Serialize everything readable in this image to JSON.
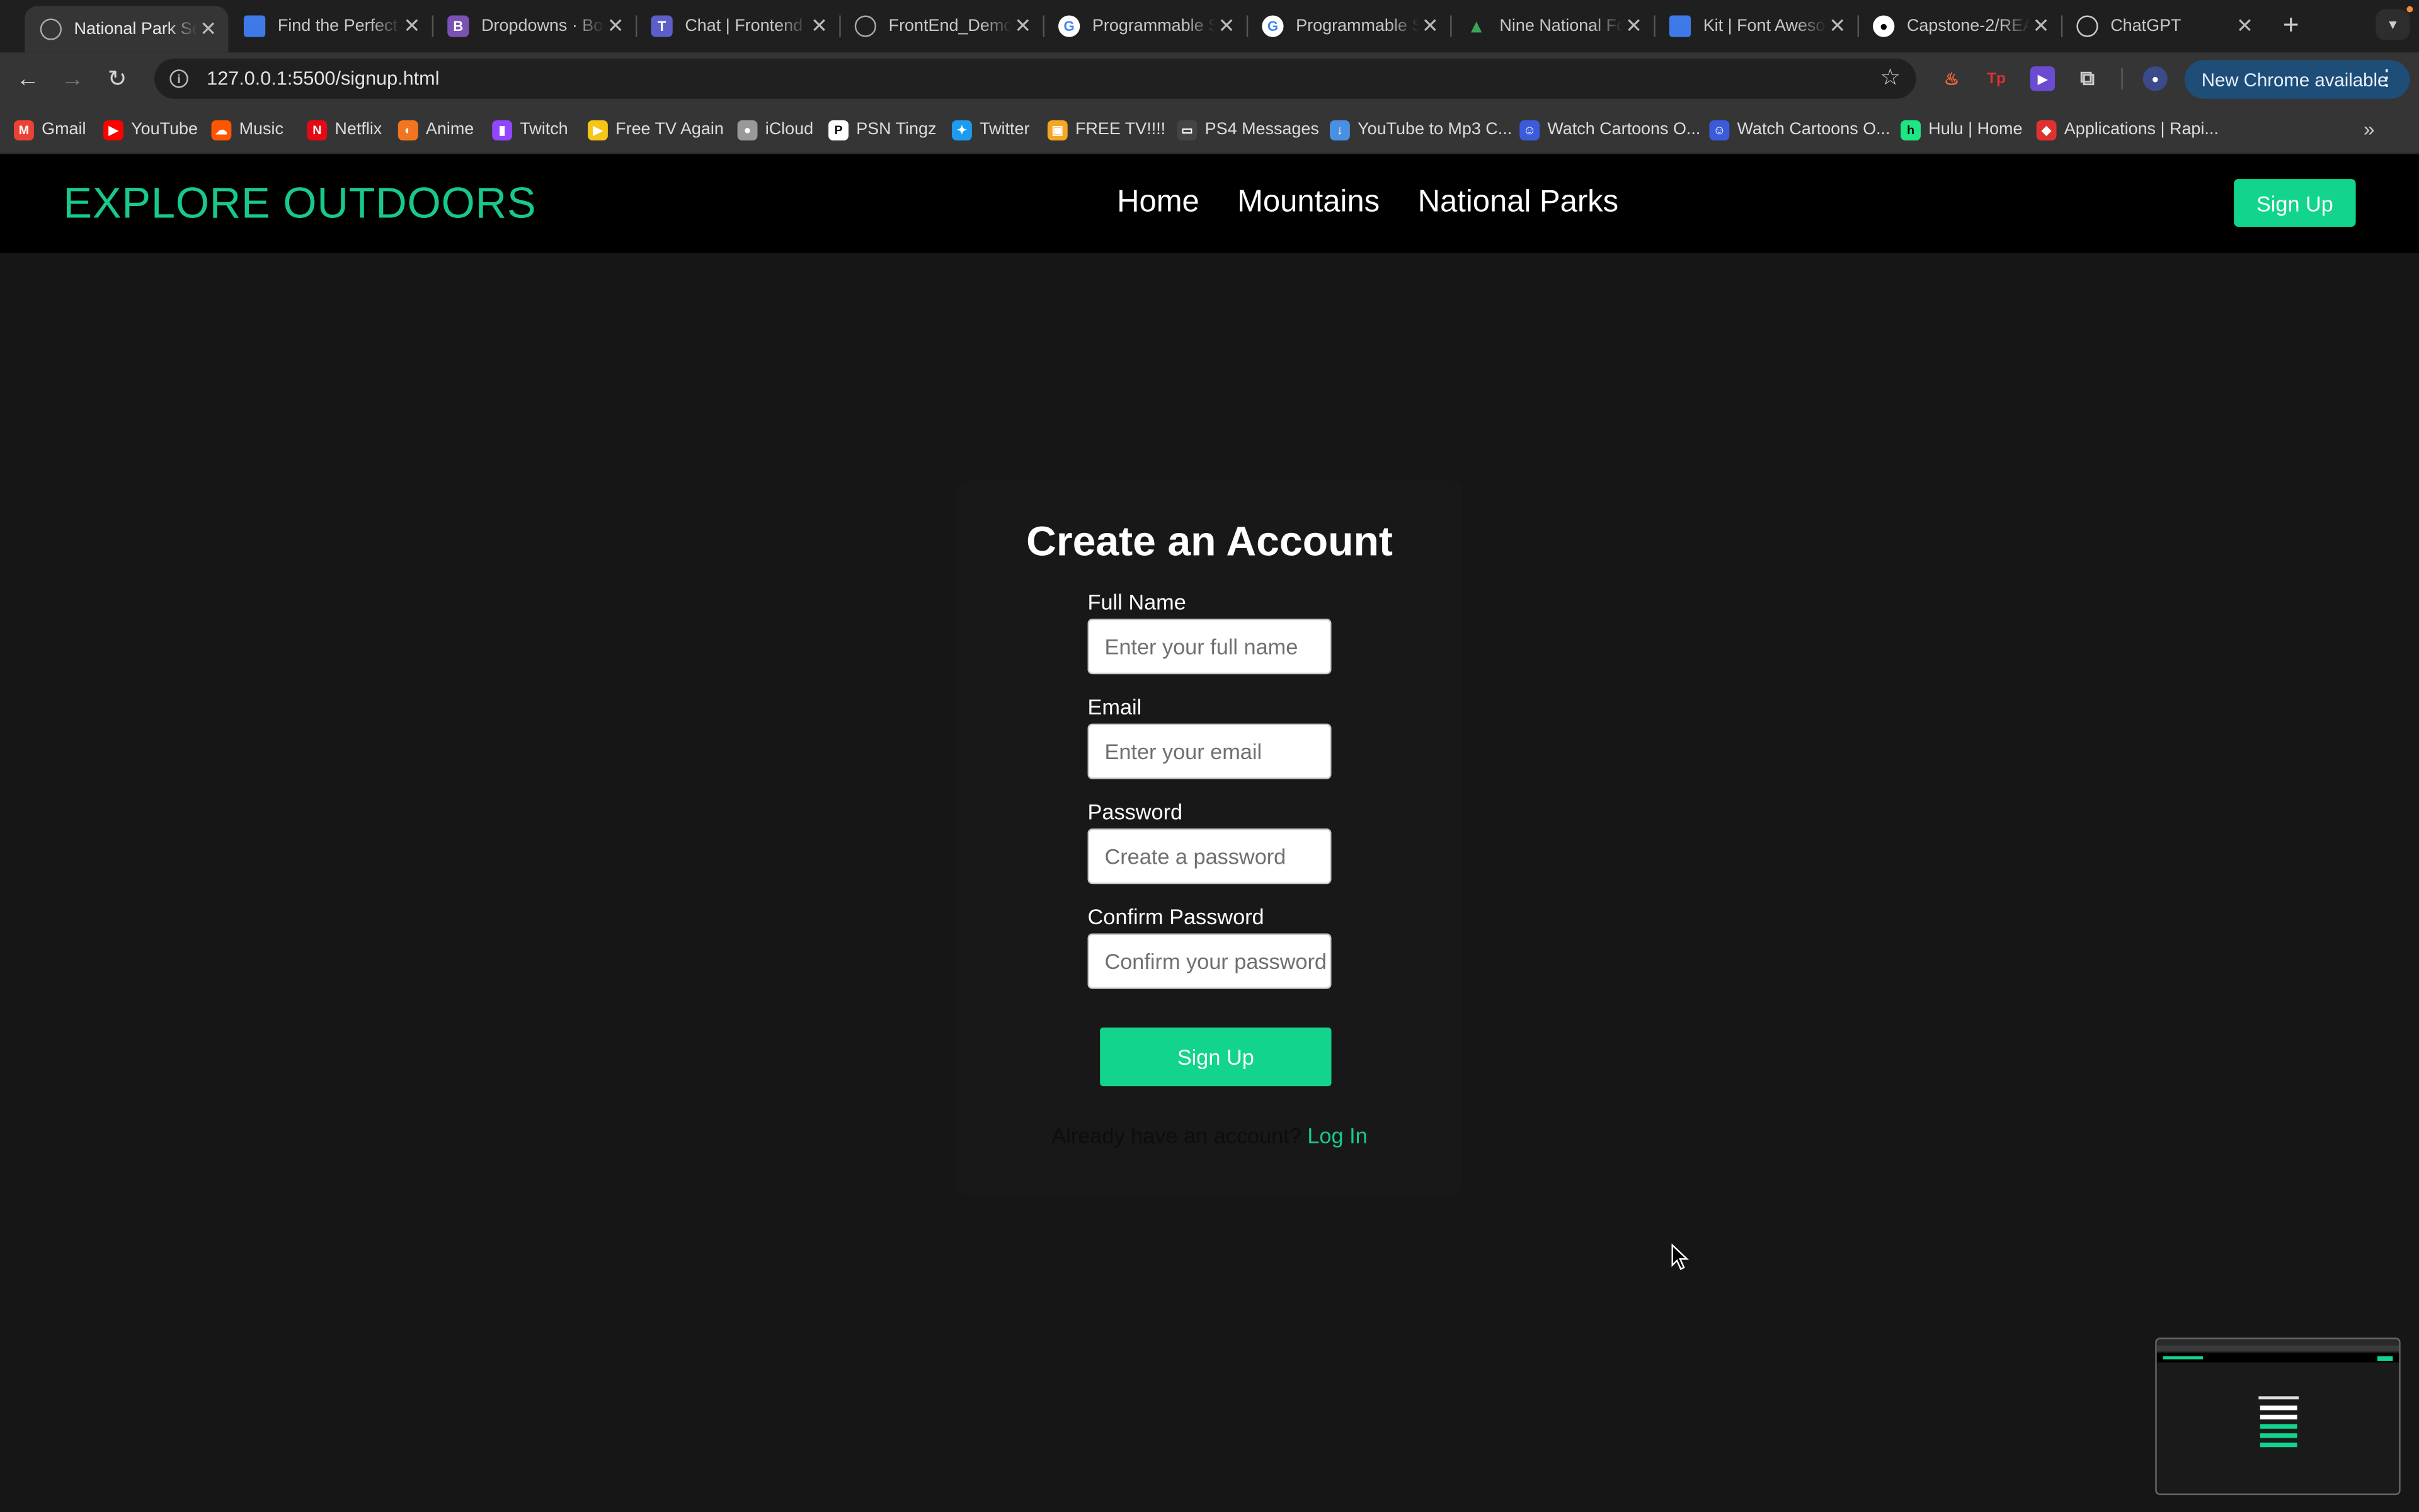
{
  "browser": {
    "tabs": [
      {
        "title": "National Park Se",
        "favicon": "globe-icon",
        "active": true
      },
      {
        "title": "Find the Perfect",
        "favicon": "flag-icon"
      },
      {
        "title": "Dropdowns · Bo",
        "favicon": "bootstrap-icon"
      },
      {
        "title": "Chat | Frontend",
        "favicon": "teams-icon"
      },
      {
        "title": "FrontEnd_Demo",
        "favicon": "globe-icon"
      },
      {
        "title": "Programmable S",
        "favicon": "google-icon"
      },
      {
        "title": "Programmable S",
        "favicon": "google-icon"
      },
      {
        "title": "Nine National Fo",
        "favicon": "tree-icon"
      },
      {
        "title": "Kit | Font Aweso",
        "favicon": "flag-icon"
      },
      {
        "title": "Capstone-2/REA",
        "favicon": "github-icon"
      },
      {
        "title": "ChatGPT",
        "favicon": "openai-icon"
      }
    ],
    "new_tab_symbol": "+",
    "close_symbol": "✕",
    "url": "127.0.0.1:5500/signup.html",
    "update_button": "New Chrome available",
    "bookmarks": [
      {
        "label": "Gmail",
        "icon": "gmail-icon",
        "color": "#ea4335"
      },
      {
        "label": "YouTube",
        "icon": "youtube-icon",
        "color": "#ff0000"
      },
      {
        "label": "Music",
        "icon": "soundcloud-icon",
        "color": "#ff5500"
      },
      {
        "label": "Netflix",
        "icon": "netflix-icon",
        "color": "#e50914"
      },
      {
        "label": "Anime",
        "icon": "crunchyroll-icon",
        "color": "#f47521"
      },
      {
        "label": "Twitch",
        "icon": "twitch-icon",
        "color": "#9146ff"
      },
      {
        "label": "Free TV Again",
        "icon": "play-icon",
        "color": "#f5c518"
      },
      {
        "label": "iCloud",
        "icon": "apple-icon",
        "color": "#999999"
      },
      {
        "label": "PSN Tingz",
        "icon": "playstation-icon",
        "color": "#ffffff"
      },
      {
        "label": "Twitter",
        "icon": "twitter-icon",
        "color": "#1d9bf0"
      },
      {
        "label": "FREE TV!!!!",
        "icon": "tv-icon",
        "color": "#f5a623"
      },
      {
        "label": "PS4 Messages",
        "icon": "message-icon",
        "color": "#444444"
      },
      {
        "label": "YouTube to Mp3 C...",
        "icon": "download-icon",
        "color": "#4a90e2"
      },
      {
        "label": "Watch Cartoons O...",
        "icon": "cartoon-icon",
        "color": "#3b5bdb"
      },
      {
        "label": "Watch Cartoons O...",
        "icon": "cartoon-icon",
        "color": "#3b5bdb"
      },
      {
        "label": "Hulu | Home",
        "icon": "hulu-icon",
        "color": "#1ce783"
      },
      {
        "label": "Applications | Rapi...",
        "icon": "rapid-icon",
        "color": "#e03131"
      }
    ]
  },
  "site": {
    "logo": "EXPLORE OUTDOORS",
    "nav": [
      "Home",
      "Mountains",
      "National Parks"
    ],
    "nav_button": "Sign Up",
    "accent_color": "#12d48c"
  },
  "form": {
    "title": "Create an Account",
    "fields": [
      {
        "label": "Full Name",
        "placeholder": "Enter your full name",
        "value": ""
      },
      {
        "label": "Email",
        "placeholder": "Enter your email",
        "value": ""
      },
      {
        "label": "Password",
        "placeholder": "Create a password",
        "value": ""
      },
      {
        "label": "Confirm Password",
        "placeholder": "Confirm your password",
        "value": ""
      }
    ],
    "submit": "Sign Up",
    "login_prompt": "Already have an account?",
    "login_link": "Log In"
  }
}
